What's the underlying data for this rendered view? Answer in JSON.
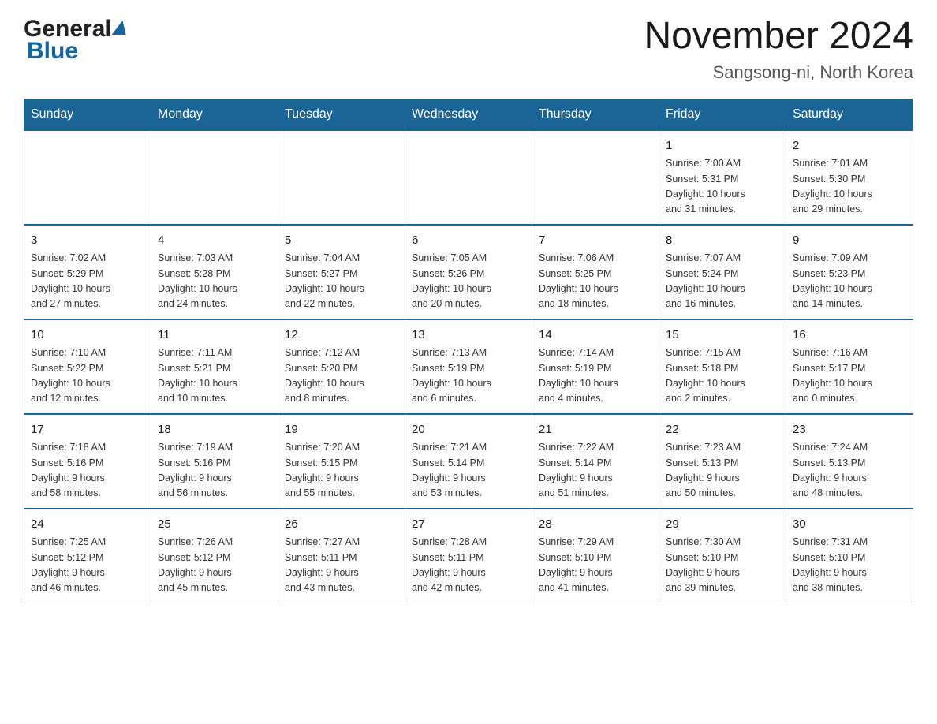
{
  "logo": {
    "general": "General",
    "blue": "Blue"
  },
  "title": "November 2024",
  "subtitle": "Sangsong-ni, North Korea",
  "days_of_week": [
    "Sunday",
    "Monday",
    "Tuesday",
    "Wednesday",
    "Thursday",
    "Friday",
    "Saturday"
  ],
  "weeks": [
    [
      {
        "day": "",
        "info": ""
      },
      {
        "day": "",
        "info": ""
      },
      {
        "day": "",
        "info": ""
      },
      {
        "day": "",
        "info": ""
      },
      {
        "day": "",
        "info": ""
      },
      {
        "day": "1",
        "info": "Sunrise: 7:00 AM\nSunset: 5:31 PM\nDaylight: 10 hours\nand 31 minutes."
      },
      {
        "day": "2",
        "info": "Sunrise: 7:01 AM\nSunset: 5:30 PM\nDaylight: 10 hours\nand 29 minutes."
      }
    ],
    [
      {
        "day": "3",
        "info": "Sunrise: 7:02 AM\nSunset: 5:29 PM\nDaylight: 10 hours\nand 27 minutes."
      },
      {
        "day": "4",
        "info": "Sunrise: 7:03 AM\nSunset: 5:28 PM\nDaylight: 10 hours\nand 24 minutes."
      },
      {
        "day": "5",
        "info": "Sunrise: 7:04 AM\nSunset: 5:27 PM\nDaylight: 10 hours\nand 22 minutes."
      },
      {
        "day": "6",
        "info": "Sunrise: 7:05 AM\nSunset: 5:26 PM\nDaylight: 10 hours\nand 20 minutes."
      },
      {
        "day": "7",
        "info": "Sunrise: 7:06 AM\nSunset: 5:25 PM\nDaylight: 10 hours\nand 18 minutes."
      },
      {
        "day": "8",
        "info": "Sunrise: 7:07 AM\nSunset: 5:24 PM\nDaylight: 10 hours\nand 16 minutes."
      },
      {
        "day": "9",
        "info": "Sunrise: 7:09 AM\nSunset: 5:23 PM\nDaylight: 10 hours\nand 14 minutes."
      }
    ],
    [
      {
        "day": "10",
        "info": "Sunrise: 7:10 AM\nSunset: 5:22 PM\nDaylight: 10 hours\nand 12 minutes."
      },
      {
        "day": "11",
        "info": "Sunrise: 7:11 AM\nSunset: 5:21 PM\nDaylight: 10 hours\nand 10 minutes."
      },
      {
        "day": "12",
        "info": "Sunrise: 7:12 AM\nSunset: 5:20 PM\nDaylight: 10 hours\nand 8 minutes."
      },
      {
        "day": "13",
        "info": "Sunrise: 7:13 AM\nSunset: 5:19 PM\nDaylight: 10 hours\nand 6 minutes."
      },
      {
        "day": "14",
        "info": "Sunrise: 7:14 AM\nSunset: 5:19 PM\nDaylight: 10 hours\nand 4 minutes."
      },
      {
        "day": "15",
        "info": "Sunrise: 7:15 AM\nSunset: 5:18 PM\nDaylight: 10 hours\nand 2 minutes."
      },
      {
        "day": "16",
        "info": "Sunrise: 7:16 AM\nSunset: 5:17 PM\nDaylight: 10 hours\nand 0 minutes."
      }
    ],
    [
      {
        "day": "17",
        "info": "Sunrise: 7:18 AM\nSunset: 5:16 PM\nDaylight: 9 hours\nand 58 minutes."
      },
      {
        "day": "18",
        "info": "Sunrise: 7:19 AM\nSunset: 5:16 PM\nDaylight: 9 hours\nand 56 minutes."
      },
      {
        "day": "19",
        "info": "Sunrise: 7:20 AM\nSunset: 5:15 PM\nDaylight: 9 hours\nand 55 minutes."
      },
      {
        "day": "20",
        "info": "Sunrise: 7:21 AM\nSunset: 5:14 PM\nDaylight: 9 hours\nand 53 minutes."
      },
      {
        "day": "21",
        "info": "Sunrise: 7:22 AM\nSunset: 5:14 PM\nDaylight: 9 hours\nand 51 minutes."
      },
      {
        "day": "22",
        "info": "Sunrise: 7:23 AM\nSunset: 5:13 PM\nDaylight: 9 hours\nand 50 minutes."
      },
      {
        "day": "23",
        "info": "Sunrise: 7:24 AM\nSunset: 5:13 PM\nDaylight: 9 hours\nand 48 minutes."
      }
    ],
    [
      {
        "day": "24",
        "info": "Sunrise: 7:25 AM\nSunset: 5:12 PM\nDaylight: 9 hours\nand 46 minutes."
      },
      {
        "day": "25",
        "info": "Sunrise: 7:26 AM\nSunset: 5:12 PM\nDaylight: 9 hours\nand 45 minutes."
      },
      {
        "day": "26",
        "info": "Sunrise: 7:27 AM\nSunset: 5:11 PM\nDaylight: 9 hours\nand 43 minutes."
      },
      {
        "day": "27",
        "info": "Sunrise: 7:28 AM\nSunset: 5:11 PM\nDaylight: 9 hours\nand 42 minutes."
      },
      {
        "day": "28",
        "info": "Sunrise: 7:29 AM\nSunset: 5:10 PM\nDaylight: 9 hours\nand 41 minutes."
      },
      {
        "day": "29",
        "info": "Sunrise: 7:30 AM\nSunset: 5:10 PM\nDaylight: 9 hours\nand 39 minutes."
      },
      {
        "day": "30",
        "info": "Sunrise: 7:31 AM\nSunset: 5:10 PM\nDaylight: 9 hours\nand 38 minutes."
      }
    ]
  ],
  "colors": {
    "header_bg": "#1a6496",
    "header_text": "#ffffff",
    "border": "#aaaaaa"
  }
}
